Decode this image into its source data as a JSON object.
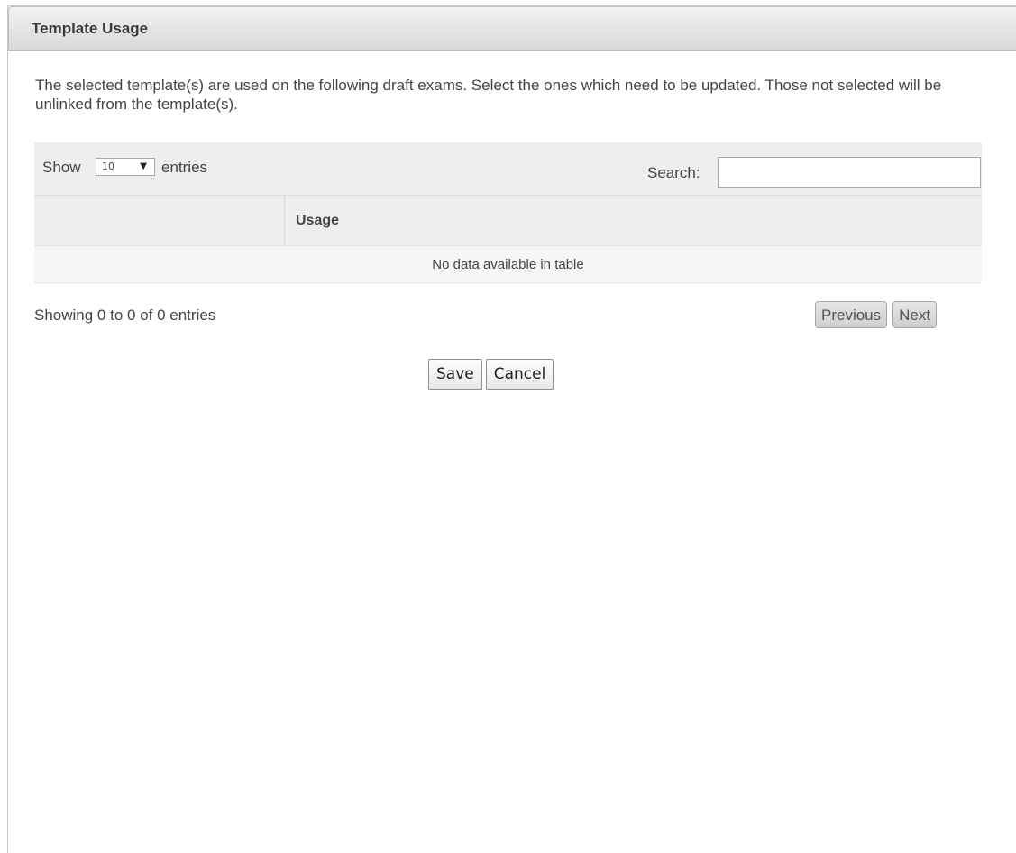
{
  "dialog": {
    "title": "Template Usage",
    "description": "The selected template(s) are used on the following draft exams. Select the ones which need to be updated. Those not selected will be unlinked from the template(s)."
  },
  "table": {
    "show_label": "Show",
    "length_value": "10",
    "entries_label": "entries",
    "search_label": "Search:",
    "search_value": "",
    "columns": [
      "",
      "Usage"
    ],
    "empty_message": "No data available in table",
    "info": "Showing 0 to 0 of 0 entries",
    "pager": {
      "previous": "Previous",
      "next": "Next"
    }
  },
  "actions": {
    "save": "Save",
    "cancel": "Cancel"
  }
}
